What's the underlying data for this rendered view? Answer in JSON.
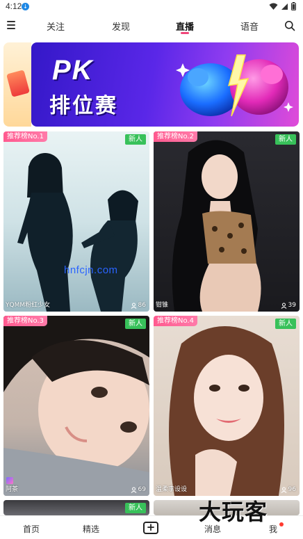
{
  "status_bar": {
    "time": "4:12"
  },
  "nav": {
    "tabs": [
      {
        "label": "关注"
      },
      {
        "label": "发现"
      },
      {
        "label": "直播"
      },
      {
        "label": "语音"
      }
    ],
    "active_tab": "直播"
  },
  "banner": {
    "title_line1": "PK",
    "title_line2": "排位赛"
  },
  "cards": [
    {
      "rank_tag": "推荐榜No.1",
      "new_badge": "新人",
      "name": "YQMM粉红少女",
      "viewers": "86"
    },
    {
      "rank_tag": "推荐榜No.2",
      "new_badge": "新人",
      "name": "钳锥",
      "viewers": "39"
    },
    {
      "rank_tag": "推荐榜No.3",
      "new_badge": "新人",
      "name": "阿茶",
      "viewers": "69"
    },
    {
      "rank_tag": "推荐榜No.4",
      "new_badge": "新人",
      "name": "温柔李设设",
      "viewers": "96"
    },
    {
      "new_badge": "新人"
    }
  ],
  "watermark": "hnfcjn.com",
  "bottom_nav": {
    "items": [
      {
        "label": "首页"
      },
      {
        "label": "精选"
      },
      {
        "label": "+"
      },
      {
        "label": "消息"
      },
      {
        "label": "我"
      }
    ]
  },
  "brand_overlay": "大玩客",
  "colors": {
    "accent": "#f0467a",
    "new_badge": "#38c15a",
    "banner_primary": "#5a27e8"
  }
}
